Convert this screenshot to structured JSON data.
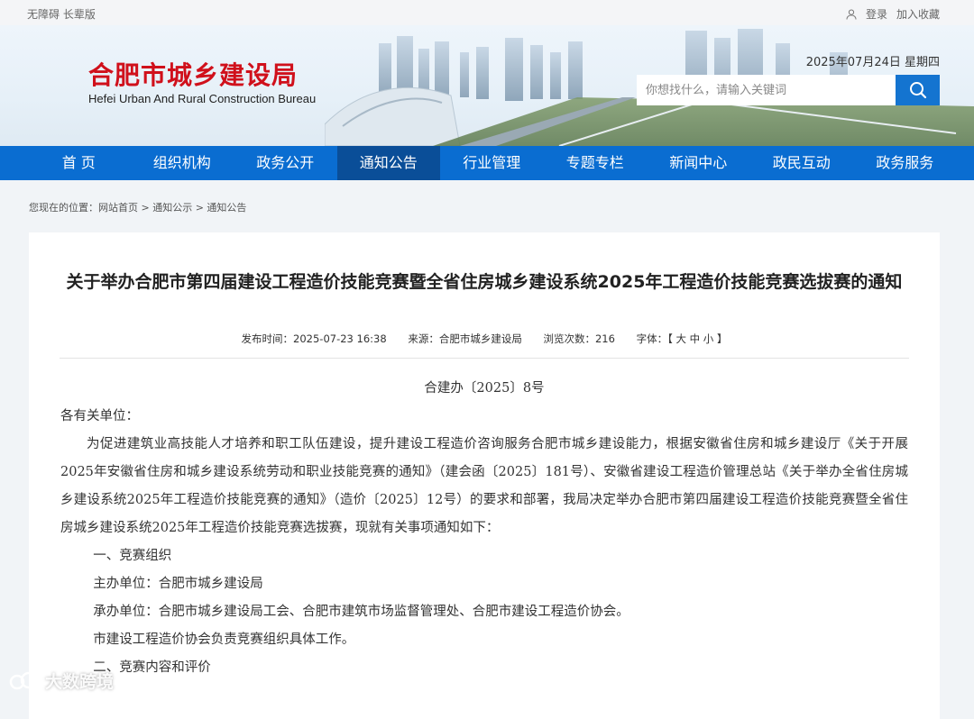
{
  "topbar": {
    "accessibility": "无障碍 长辈版",
    "login": "登录",
    "favorite": "加入收藏"
  },
  "header": {
    "logo_cn": "合肥市城乡建设局",
    "logo_en": "Hefei Urban And Rural Construction Bureau",
    "date": "2025年07月24日 星期四",
    "search_placeholder": "你想找什么，请输入关键词"
  },
  "nav": {
    "items": [
      "首 页",
      "组织机构",
      "政务公开",
      "通知公告",
      "行业管理",
      "专题专栏",
      "新闻中心",
      "政民互动",
      "政务服务"
    ],
    "active_index": 3
  },
  "breadcrumb": "您现在的位置：网站首页 > 通知公示 > 通知公告",
  "article": {
    "title": "关于举办合肥市第四届建设工程造价技能竞赛暨全省住房城乡建设系统2025年工程造价技能竞赛选拔赛的通知",
    "meta": {
      "publish": "发布时间：2025-07-23 16:38",
      "source": "来源：合肥市城乡建设局",
      "views": "浏览次数：216",
      "font_size": "字体：【 大 中 小 】"
    },
    "doc_number": "合建办〔2025〕8号",
    "salutation": "各有关单位：",
    "paragraph": "为促进建筑业高技能人才培养和职工队伍建设，提升建设工程造价咨询服务合肥市城乡建设能力，根据安徽省住房和城乡建设厅《关于开展2025年安徽省住房和城乡建设系统劳动和职业技能竞赛的通知》（建会函〔2025〕181号）、安徽省建设工程造价管理总站《关于举办全省住房城乡建设系统2025年工程造价技能竞赛的通知》（造价〔2025〕12号）的要求和部署，我局决定举办合肥市第四届建设工程造价技能竞赛暨全省住房城乡建设系统2025年工程造价技能竞赛选拔赛，现就有关事项通知如下：",
    "section1": "一、竞赛组织",
    "host": "主办单位：合肥市城乡建设局",
    "organizer": "承办单位：合肥市城乡建设局工会、合肥市建筑市场监督管理处、合肥市建设工程造价协会。",
    "note": "市建设工程造价协会负责竞赛组织具体工作。",
    "next": "二、竞赛内容和评价"
  },
  "watermark": "大数跨境",
  "colors": {
    "nav_bg": "#0a6dd1",
    "nav_active": "#0a4e98",
    "logo_red": "#d0101b",
    "search_btn": "#1474d0"
  }
}
